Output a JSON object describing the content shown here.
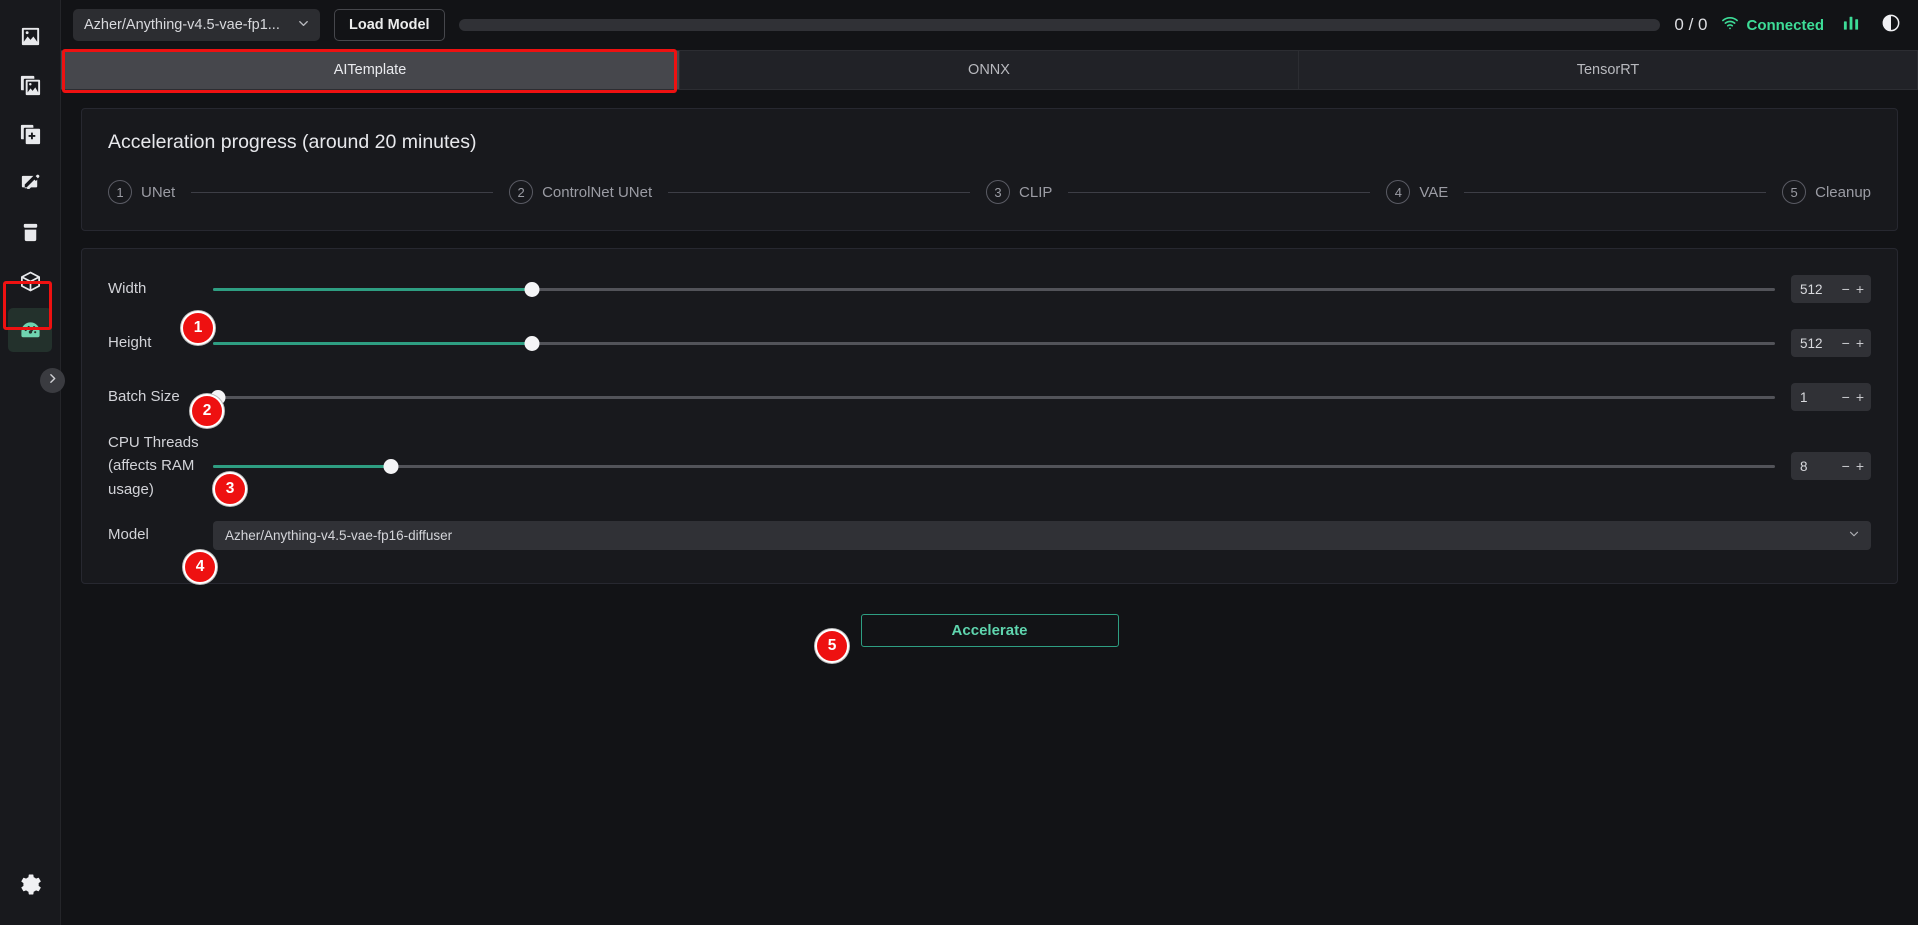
{
  "sidebar": {
    "items": [
      {
        "name": "image",
        "label": "Image"
      },
      {
        "name": "gallery",
        "label": "Gallery"
      },
      {
        "name": "add-layer",
        "label": "Add Layer"
      },
      {
        "name": "edit",
        "label": "Edit"
      },
      {
        "name": "archive",
        "label": "Archive"
      },
      {
        "name": "cube",
        "label": "Models"
      },
      {
        "name": "gauge",
        "label": "Acceleration"
      }
    ],
    "bottom_item": {
      "name": "settings",
      "label": "Settings"
    },
    "collapse_label": "Expand sidebar"
  },
  "topbar": {
    "model_value": "Azher/Anything-v4.5-vae-fp1...",
    "load_model_label": "Load Model",
    "progress_percent": 0,
    "counter": "0 / 0",
    "connection_status": "Connected",
    "stats_icon": "bar-chart-icon",
    "theme_icon": "contrast-icon",
    "accent_color": "#3ddc97"
  },
  "tabs": [
    {
      "label": "AITemplate",
      "active": true
    },
    {
      "label": "ONNX",
      "active": false
    },
    {
      "label": "TensorRT",
      "active": false
    }
  ],
  "progress_panel": {
    "title": "Acceleration progress (around 20 minutes)",
    "steps": [
      {
        "number": "1",
        "label": "UNet"
      },
      {
        "number": "2",
        "label": "ControlNet UNet"
      },
      {
        "number": "3",
        "label": "CLIP"
      },
      {
        "number": "4",
        "label": "VAE"
      },
      {
        "number": "5",
        "label": "Cleanup"
      }
    ]
  },
  "form": {
    "width": {
      "label": "Width",
      "value": "512",
      "percent": 20.4,
      "minus": "−",
      "plus": "+"
    },
    "height": {
      "label": "Height",
      "value": "512",
      "percent": 20.4,
      "minus": "−",
      "plus": "+"
    },
    "batch_size": {
      "label": "Batch Size",
      "value": "1",
      "percent": 0.3,
      "minus": "−",
      "plus": "+"
    },
    "cpu_threads": {
      "label": "CPU Threads (affects RAM usage)",
      "value": "8",
      "percent": 11.4,
      "minus": "−",
      "plus": "+"
    },
    "model": {
      "label": "Model",
      "value": "Azher/Anything-v4.5-vae-fp16-diffuser"
    },
    "accelerate_label": "Accelerate",
    "slider_fill_color": "#2e9e82"
  },
  "annotations": {
    "badges": [
      {
        "number": "1"
      },
      {
        "number": "2"
      },
      {
        "number": "3"
      },
      {
        "number": "4"
      },
      {
        "number": "5"
      }
    ],
    "box_color": "#ee1111"
  }
}
